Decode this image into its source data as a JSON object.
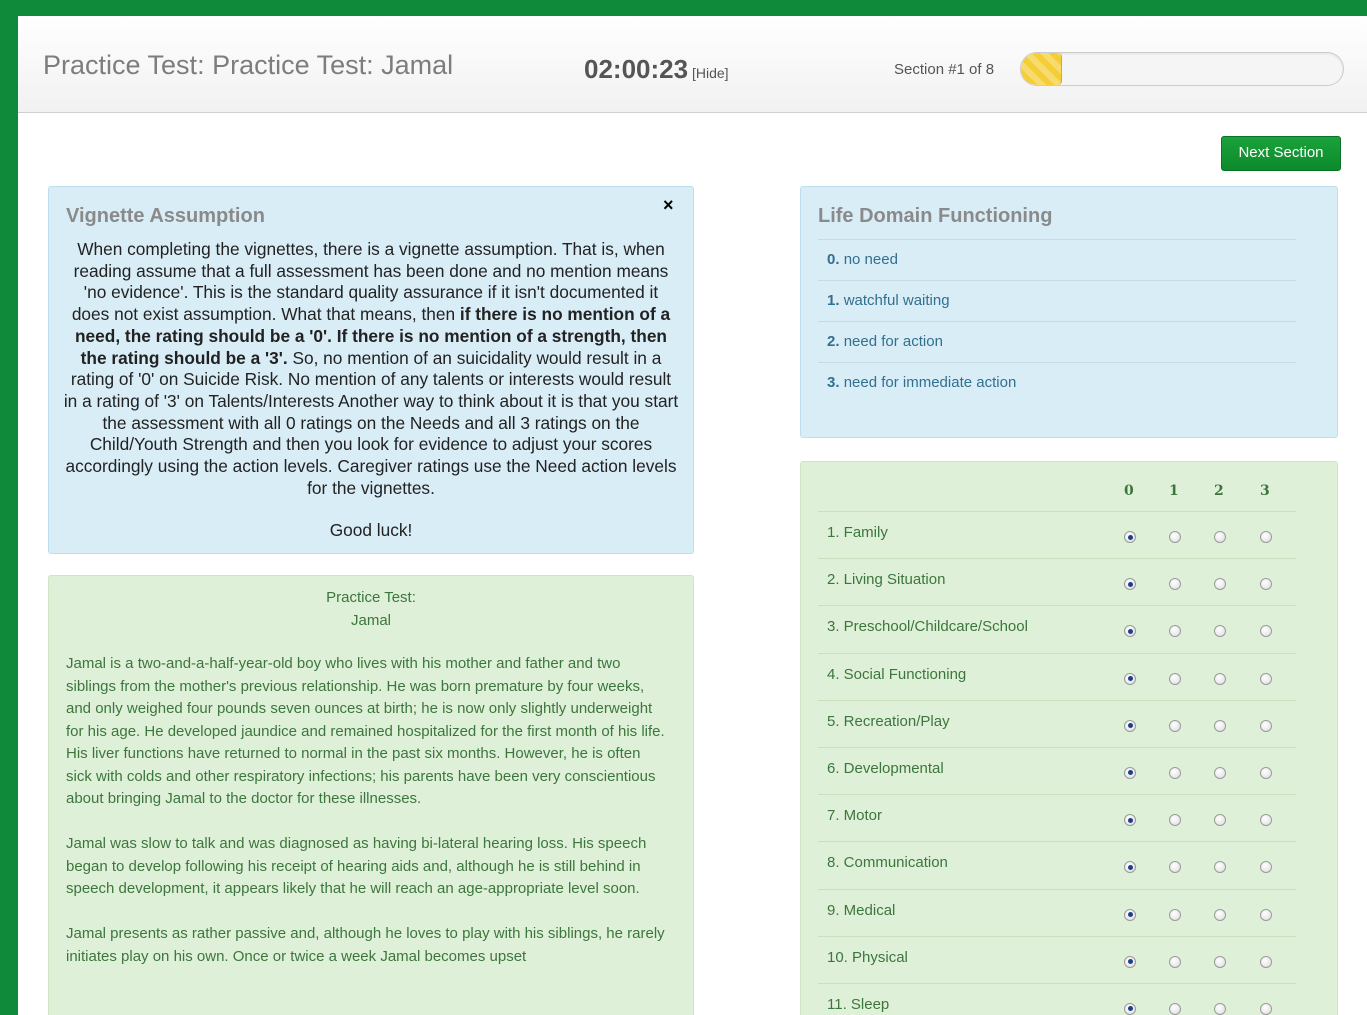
{
  "header": {
    "title": "Practice Test: Practice Test: Jamal",
    "timer": "02:00:23",
    "hide_label": "[Hide]",
    "section_label": "Section #1 of 8",
    "progress_fraction": 0.125
  },
  "next_section_label": "Next Section",
  "vignette": {
    "title": "Vignette Assumption",
    "close_symbol": "×",
    "text_part1": "When completing the vignettes, there is a vignette assumption. That is, when reading assume that a full assessment has been done and no mention means 'no evidence'. This is the standard quality assurance if it isn't documented it does not exist assumption. What that means, then ",
    "text_bold": "if there is no mention of a need, the rating should be a '0'. If there is no mention of a strength, then the rating should be a '3'.",
    "text_part2": " So, no mention of an suicidality would result in a rating of '0' on Suicide Risk. No mention of any talents or interests would result in a rating of '3' on Talents/Interests Another way to think about it is that you start the assessment with all 0 ratings on the Needs and all 3 ratings on the Child/Youth Strength and then you look for evidence to adjust your scores accordingly using the action levels.   Caregiver ratings use the Need action levels for the vignettes.",
    "closing": "Good luck!"
  },
  "story": {
    "heading_line1": "Practice Test:",
    "heading_line2": "Jamal",
    "paragraphs": [
      "Jamal is a two-and-a-half-year-old boy who lives with his mother and father and two siblings from the mother's previous relationship.   He was born premature by four weeks, and only weighed four pounds seven ounces at birth; he is now only slightly underweight for his age.  He developed jaundice and remained hospitalized for the first month of his life.  His liver functions have returned to normal in the past six months.  However, he is often sick with colds and other respiratory infections; his parents have been very conscientious about bringing Jamal to the doctor for these illnesses.",
      "Jamal was slow to talk and was diagnosed as having bi-lateral hearing loss.  His speech began to develop following his receipt of hearing aids and, although he is still behind in speech development, it appears likely that he will reach an age-appropriate level soon.",
      "Jamal presents as rather passive and, although he loves to play with his siblings, he rarely initiates play on his own.  Once or twice a week Jamal becomes upset"
    ]
  },
  "ldf": {
    "title": "Life Domain Functioning",
    "levels": [
      {
        "num": "0.",
        "label": "no need"
      },
      {
        "num": "1.",
        "label": "watchful waiting"
      },
      {
        "num": "2.",
        "label": "need for action"
      },
      {
        "num": "3.",
        "label": "need for immediate action"
      }
    ]
  },
  "ratings": {
    "columns": [
      "0",
      "1",
      "2",
      "3"
    ],
    "items": [
      {
        "label": "1. Family",
        "selected": 0
      },
      {
        "label": "2. Living Situation",
        "selected": 0
      },
      {
        "label": "3. Preschool/Childcare/School",
        "selected": 0
      },
      {
        "label": "4. Social Functioning",
        "selected": 0
      },
      {
        "label": "5. Recreation/Play",
        "selected": 0
      },
      {
        "label": "6. Developmental",
        "selected": 0
      },
      {
        "label": "7. Motor",
        "selected": 0
      },
      {
        "label": "8. Communication",
        "selected": 0
      },
      {
        "label": "9. Medical",
        "selected": 0
      },
      {
        "label": "10. Physical",
        "selected": 0
      },
      {
        "label": "11. Sleep",
        "selected": 0
      }
    ]
  },
  "colors": {
    "frame_green": "#0e8a3a",
    "button_green": "#119b35",
    "info_blue_bg": "#d9edf7",
    "success_green_bg": "#dff0d8",
    "progress_yellow": "#f5cd37"
  }
}
